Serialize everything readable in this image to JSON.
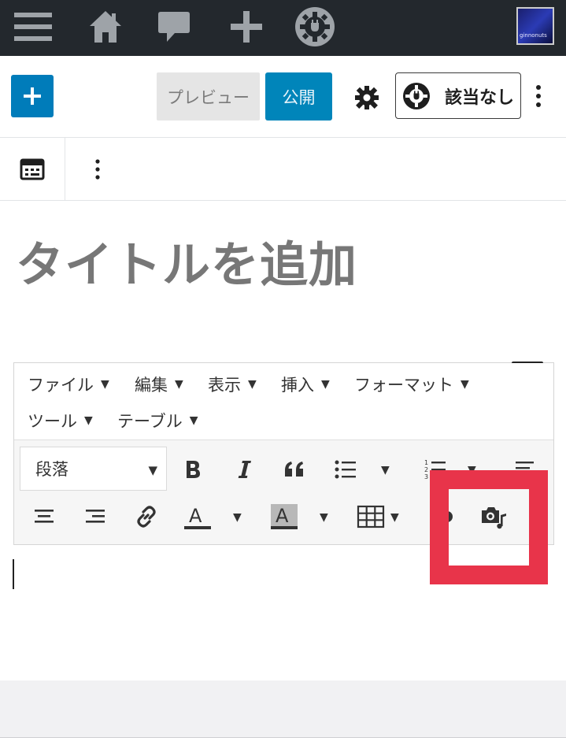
{
  "adminbar": {
    "icons": [
      "menu-icon",
      "home-icon",
      "comment-icon",
      "plus-icon",
      "plugin-gear-icon"
    ],
    "avatar_text": "ginnonuts",
    "background": "#23282d"
  },
  "header": {
    "add_block_icon": "plus-icon",
    "preview_label": "プレビュー",
    "publish_label": "公開",
    "settings_icon": "gear-icon",
    "plugin_label": "該当なし",
    "more_icon": "vertical-ellipsis-icon",
    "accent_color": "#007cba"
  },
  "blockbar": {
    "block_icon": "classic-block-icon",
    "more_icon": "vertical-ellipsis-icon"
  },
  "post": {
    "title_placeholder": "タイトルを追加"
  },
  "editor": {
    "menus": [
      {
        "label": "ファイル"
      },
      {
        "label": "編集"
      },
      {
        "label": "表示"
      },
      {
        "label": "挿入"
      },
      {
        "label": "フォーマット"
      },
      {
        "label": "ツール"
      },
      {
        "label": "テーブル"
      }
    ],
    "menu_caret": "▼",
    "format_value": "段落",
    "toolbar_icons": [
      "bold-icon",
      "italic-icon",
      "blockquote-icon",
      "bullet-list-icon",
      "numbered-list-icon",
      "align-left-icon",
      "align-center-icon",
      "align-right-icon",
      "link-icon",
      "text-color-icon",
      "background-color-icon",
      "table-icon",
      "undo-icon",
      "add-media-icon"
    ]
  },
  "highlight_color": "#e8344a"
}
